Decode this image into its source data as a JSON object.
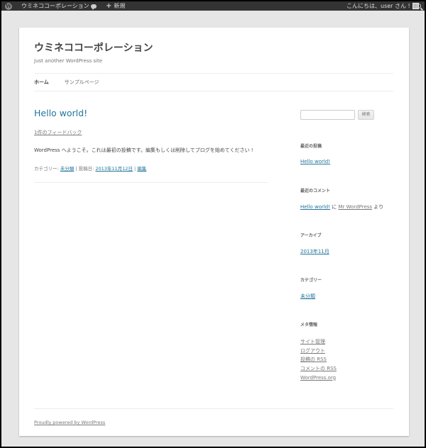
{
  "adminbar": {
    "wp_logo_glyph": "W",
    "site_name": "ウミネココーポレーション",
    "new_label": "新規",
    "plus_glyph": "+",
    "greeting": "こんにちは、user さん !"
  },
  "site": {
    "title": "ウミネココーポレーション",
    "description": "Just another WordPress site"
  },
  "nav": {
    "items": [
      {
        "label": "ホーム"
      },
      {
        "label": "サンプルページ"
      }
    ]
  },
  "post": {
    "title": "Hello world!",
    "comments_link": "1件のフィードバック",
    "body": "WordPress へようこそ。これは最初の投稿です。編集もしくは削除してブログを始めてください !",
    "meta": {
      "category_label": "カテゴリー: ",
      "category": "未分類",
      "sep1": " | ",
      "posted_label": "投稿日: ",
      "date": "2013年11月12日",
      "sep2": " | ",
      "edit": "編集"
    }
  },
  "sidebar": {
    "search_button": "検索",
    "recent_posts_title": "最近の投稿",
    "recent_post": "Hello world!",
    "recent_comments_title": "最近のコメント",
    "comment_post": "Hello world!",
    "comment_ni": " に ",
    "comment_author": "Mr WordPress",
    "comment_yori": " より",
    "archives_title": "アーカイブ",
    "archive_item": "2013年11月",
    "categories_title": "カテゴリー",
    "category_item": "未分類",
    "meta_title": "メタ情報",
    "meta_links": [
      "サイト管理",
      "ログアウト",
      "投稿の RSS",
      "コメントの RSS",
      "WordPress.org"
    ]
  },
  "footer": {
    "powered": "Proudly powered by WordPress"
  },
  "colors": {
    "link": "#21759b",
    "adminbar": "#333333",
    "background": "#e6e6e6"
  }
}
